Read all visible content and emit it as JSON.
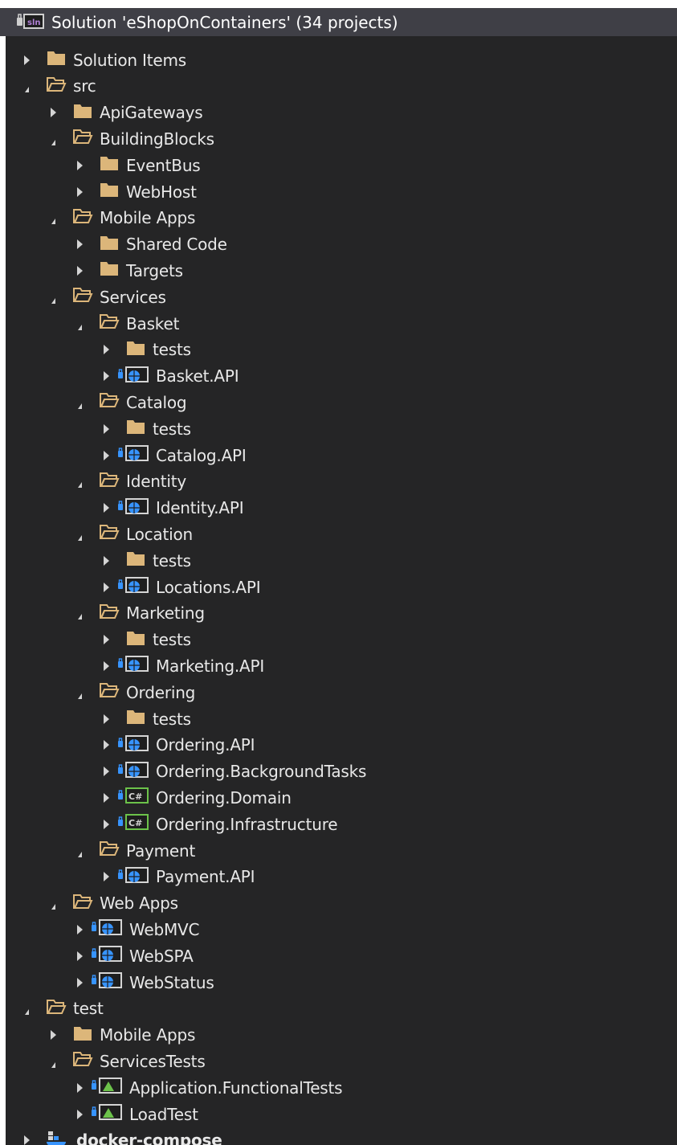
{
  "window": {
    "solution_title": "Solution 'eShopOnContainers' (34 projects)"
  },
  "colors": {
    "folder": "#dcb67a",
    "panel": "#252526",
    "header": "#3f3f46",
    "text": "#e8e8e8",
    "web_project": "#3794ff",
    "csharp": "#6cc24a",
    "test": "#6cc24a"
  },
  "tree": [
    {
      "label": "Solution Items",
      "level": 0,
      "state": "collapsed",
      "icon": "folder-closed-icon"
    },
    {
      "label": "src",
      "level": 0,
      "state": "expanded",
      "icon": "folder-open-icon"
    },
    {
      "label": "ApiGateways",
      "level": 1,
      "state": "collapsed",
      "icon": "folder-closed-icon"
    },
    {
      "label": "BuildingBlocks",
      "level": 1,
      "state": "expanded",
      "icon": "folder-open-icon"
    },
    {
      "label": "EventBus",
      "level": 2,
      "state": "collapsed",
      "icon": "folder-closed-icon"
    },
    {
      "label": "WebHost",
      "level": 2,
      "state": "collapsed",
      "icon": "folder-closed-icon"
    },
    {
      "label": "Mobile Apps",
      "level": 1,
      "state": "expanded",
      "icon": "folder-open-icon"
    },
    {
      "label": "Shared Code",
      "level": 2,
      "state": "collapsed",
      "icon": "folder-closed-icon"
    },
    {
      "label": "Targets",
      "level": 2,
      "state": "collapsed",
      "icon": "folder-closed-icon"
    },
    {
      "label": "Services",
      "level": 1,
      "state": "expanded",
      "icon": "folder-open-icon"
    },
    {
      "label": "Basket",
      "level": 2,
      "state": "expanded",
      "icon": "folder-open-icon"
    },
    {
      "label": "tests",
      "level": 3,
      "state": "collapsed",
      "icon": "folder-closed-icon"
    },
    {
      "label": "Basket.API",
      "level": 3,
      "state": "collapsed",
      "icon": "web-project-icon"
    },
    {
      "label": "Catalog",
      "level": 2,
      "state": "expanded",
      "icon": "folder-open-icon"
    },
    {
      "label": "tests",
      "level": 3,
      "state": "collapsed",
      "icon": "folder-closed-icon"
    },
    {
      "label": "Catalog.API",
      "level": 3,
      "state": "collapsed",
      "icon": "web-project-icon"
    },
    {
      "label": "Identity",
      "level": 2,
      "state": "expanded",
      "icon": "folder-open-icon"
    },
    {
      "label": "Identity.API",
      "level": 3,
      "state": "collapsed",
      "icon": "web-project-icon"
    },
    {
      "label": "Location",
      "level": 2,
      "state": "expanded",
      "icon": "folder-open-icon"
    },
    {
      "label": "tests",
      "level": 3,
      "state": "collapsed",
      "icon": "folder-closed-icon"
    },
    {
      "label": "Locations.API",
      "level": 3,
      "state": "collapsed",
      "icon": "web-project-icon"
    },
    {
      "label": "Marketing",
      "level": 2,
      "state": "expanded",
      "icon": "folder-open-icon"
    },
    {
      "label": "tests",
      "level": 3,
      "state": "collapsed",
      "icon": "folder-closed-icon"
    },
    {
      "label": "Marketing.API",
      "level": 3,
      "state": "collapsed",
      "icon": "web-project-icon"
    },
    {
      "label": "Ordering",
      "level": 2,
      "state": "expanded",
      "icon": "folder-open-icon"
    },
    {
      "label": "tests",
      "level": 3,
      "state": "collapsed",
      "icon": "folder-closed-icon"
    },
    {
      "label": "Ordering.API",
      "level": 3,
      "state": "collapsed",
      "icon": "web-project-icon"
    },
    {
      "label": "Ordering.BackgroundTasks",
      "level": 3,
      "state": "collapsed",
      "icon": "web-project-icon"
    },
    {
      "label": "Ordering.Domain",
      "level": 3,
      "state": "collapsed",
      "icon": "csharp-project-icon"
    },
    {
      "label": "Ordering.Infrastructure",
      "level": 3,
      "state": "collapsed",
      "icon": "csharp-project-icon"
    },
    {
      "label": "Payment",
      "level": 2,
      "state": "expanded",
      "icon": "folder-open-icon"
    },
    {
      "label": "Payment.API",
      "level": 3,
      "state": "collapsed",
      "icon": "web-project-icon"
    },
    {
      "label": "Web Apps",
      "level": 1,
      "state": "expanded",
      "icon": "folder-open-icon"
    },
    {
      "label": "WebMVC",
      "level": 2,
      "state": "collapsed",
      "icon": "web-project-icon"
    },
    {
      "label": "WebSPA",
      "level": 2,
      "state": "collapsed",
      "icon": "web-project-icon"
    },
    {
      "label": "WebStatus",
      "level": 2,
      "state": "collapsed",
      "icon": "web-project-icon"
    },
    {
      "label": "test",
      "level": 0,
      "state": "expanded",
      "icon": "folder-open-icon"
    },
    {
      "label": "Mobile Apps",
      "level": 1,
      "state": "collapsed",
      "icon": "folder-closed-icon"
    },
    {
      "label": "ServicesTests",
      "level": 1,
      "state": "expanded",
      "icon": "folder-open-icon"
    },
    {
      "label": "Application.FunctionalTests",
      "level": 2,
      "state": "collapsed",
      "icon": "test-project-icon"
    },
    {
      "label": "LoadTest",
      "level": 2,
      "state": "collapsed",
      "icon": "test-project-icon"
    },
    {
      "label": "docker-compose",
      "level": 0,
      "state": "collapsed",
      "icon": "docker-compose-icon",
      "bold": true
    }
  ]
}
